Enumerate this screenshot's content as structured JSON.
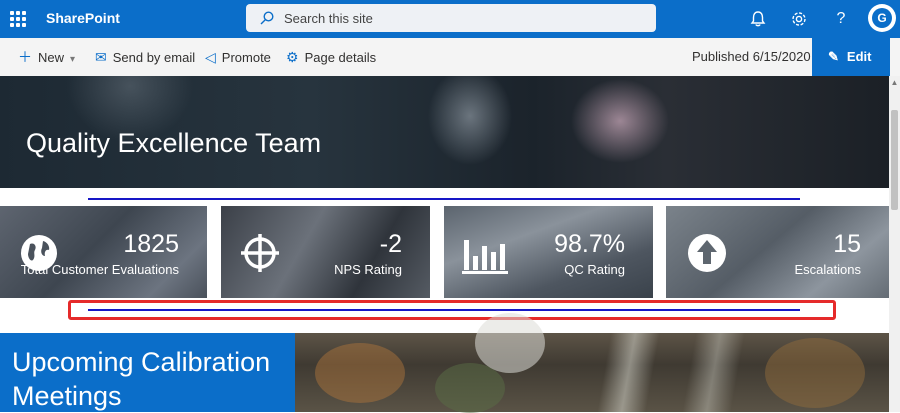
{
  "app": {
    "brand": "SharePoint",
    "search_placeholder": "Search this site"
  },
  "topbar": {
    "icons": [
      "bell-icon",
      "gear-icon",
      "help-icon"
    ],
    "help_glyph": "?",
    "avatar_initial": "G"
  },
  "commandbar": {
    "new_label": "New",
    "send_label": "Send by email",
    "promote_label": "Promote",
    "details_label": "Page details",
    "published": "Published 6/15/2020",
    "edit_label": "Edit"
  },
  "hero": {
    "title": "Quality Excellence Team"
  },
  "kpis": [
    {
      "value": "1825",
      "label": "Total Customer Evaluations",
      "icon": "globe-icon"
    },
    {
      "value": "-2",
      "label": "NPS Rating",
      "icon": "crosshair-icon"
    },
    {
      "value": "98.7%",
      "label": "QC Rating",
      "icon": "bar-chart-icon"
    },
    {
      "value": "15",
      "label": "Escalations",
      "icon": "up-arrow-circle-icon"
    }
  ],
  "section": {
    "title": "Upcoming Calibration Meetings"
  },
  "colors": {
    "brand": "#0b6ec9",
    "highlight": "#e52a2a",
    "divider": "#1717c6"
  }
}
